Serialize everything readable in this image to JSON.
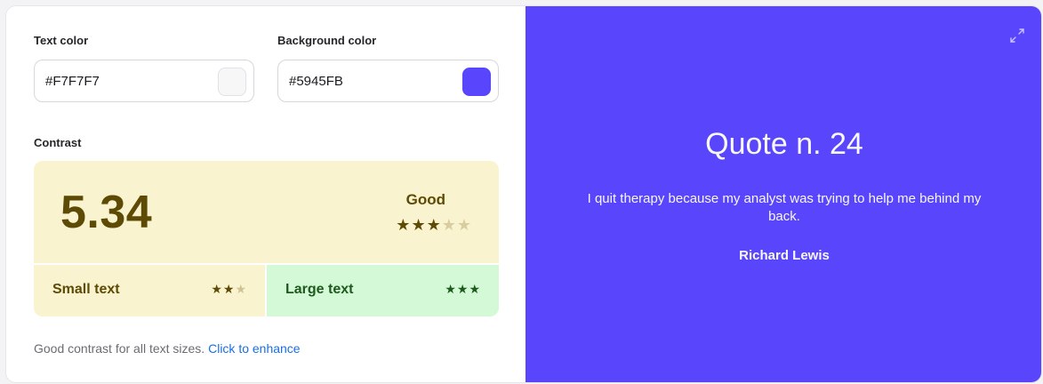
{
  "text_color": {
    "label": "Text color",
    "value": "#F7F7F7",
    "swatch": "#F7F7F7"
  },
  "background_color": {
    "label": "Background color",
    "value": "#5945FB",
    "swatch": "#5945FB"
  },
  "contrast": {
    "label": "Contrast",
    "ratio": "5.34",
    "rating": "Good",
    "overall_stars": {
      "filled": 3,
      "total": 5
    },
    "small_text": {
      "label": "Small text",
      "stars": {
        "filled": 2,
        "total": 3
      }
    },
    "large_text": {
      "label": "Large text",
      "stars": {
        "filled": 3,
        "total": 3
      }
    },
    "colors": {
      "box_bg": "#FAF3D0",
      "large_bg": "#D4F9D6",
      "accent": "#5c4a05",
      "large_accent": "#1e5a1e"
    }
  },
  "footer": {
    "note": "Good contrast for all text sizes.",
    "link": "Click to enhance"
  },
  "preview": {
    "title": "Quote n. 24",
    "text": "I quit therapy because my analyst was trying to help me behind my back.",
    "author": "Richard Lewis",
    "expand_icon": "expand-icon"
  }
}
